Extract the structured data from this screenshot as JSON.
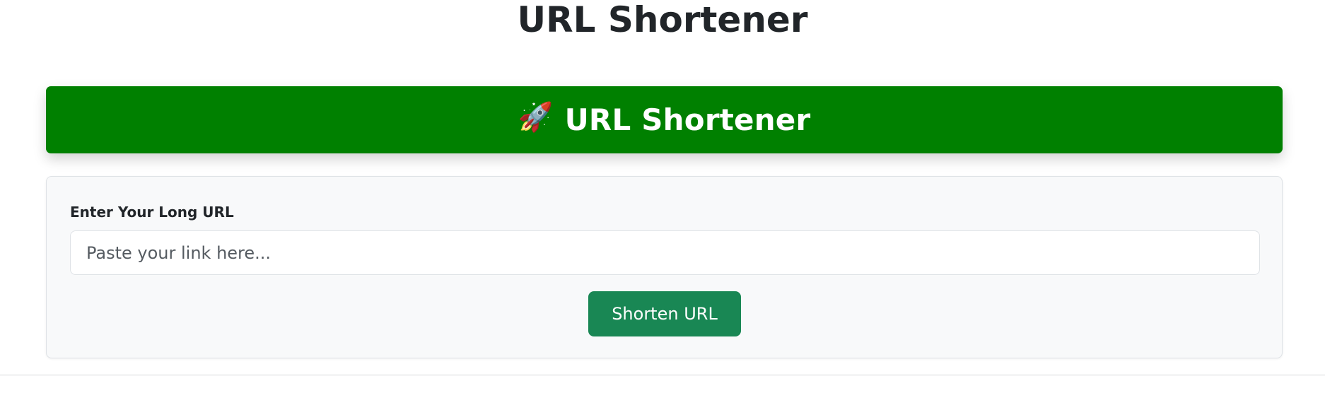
{
  "page": {
    "title": "URL Shortener"
  },
  "hero": {
    "icon": "rocket-icon",
    "icon_glyph": "🚀",
    "title": "URL Shortener",
    "background": "#008000"
  },
  "form": {
    "label": "Enter Your Long URL",
    "input_value": "",
    "input_placeholder": "Paste your link here...",
    "submit_label": "Shorten URL",
    "submit_color": "#198754"
  }
}
